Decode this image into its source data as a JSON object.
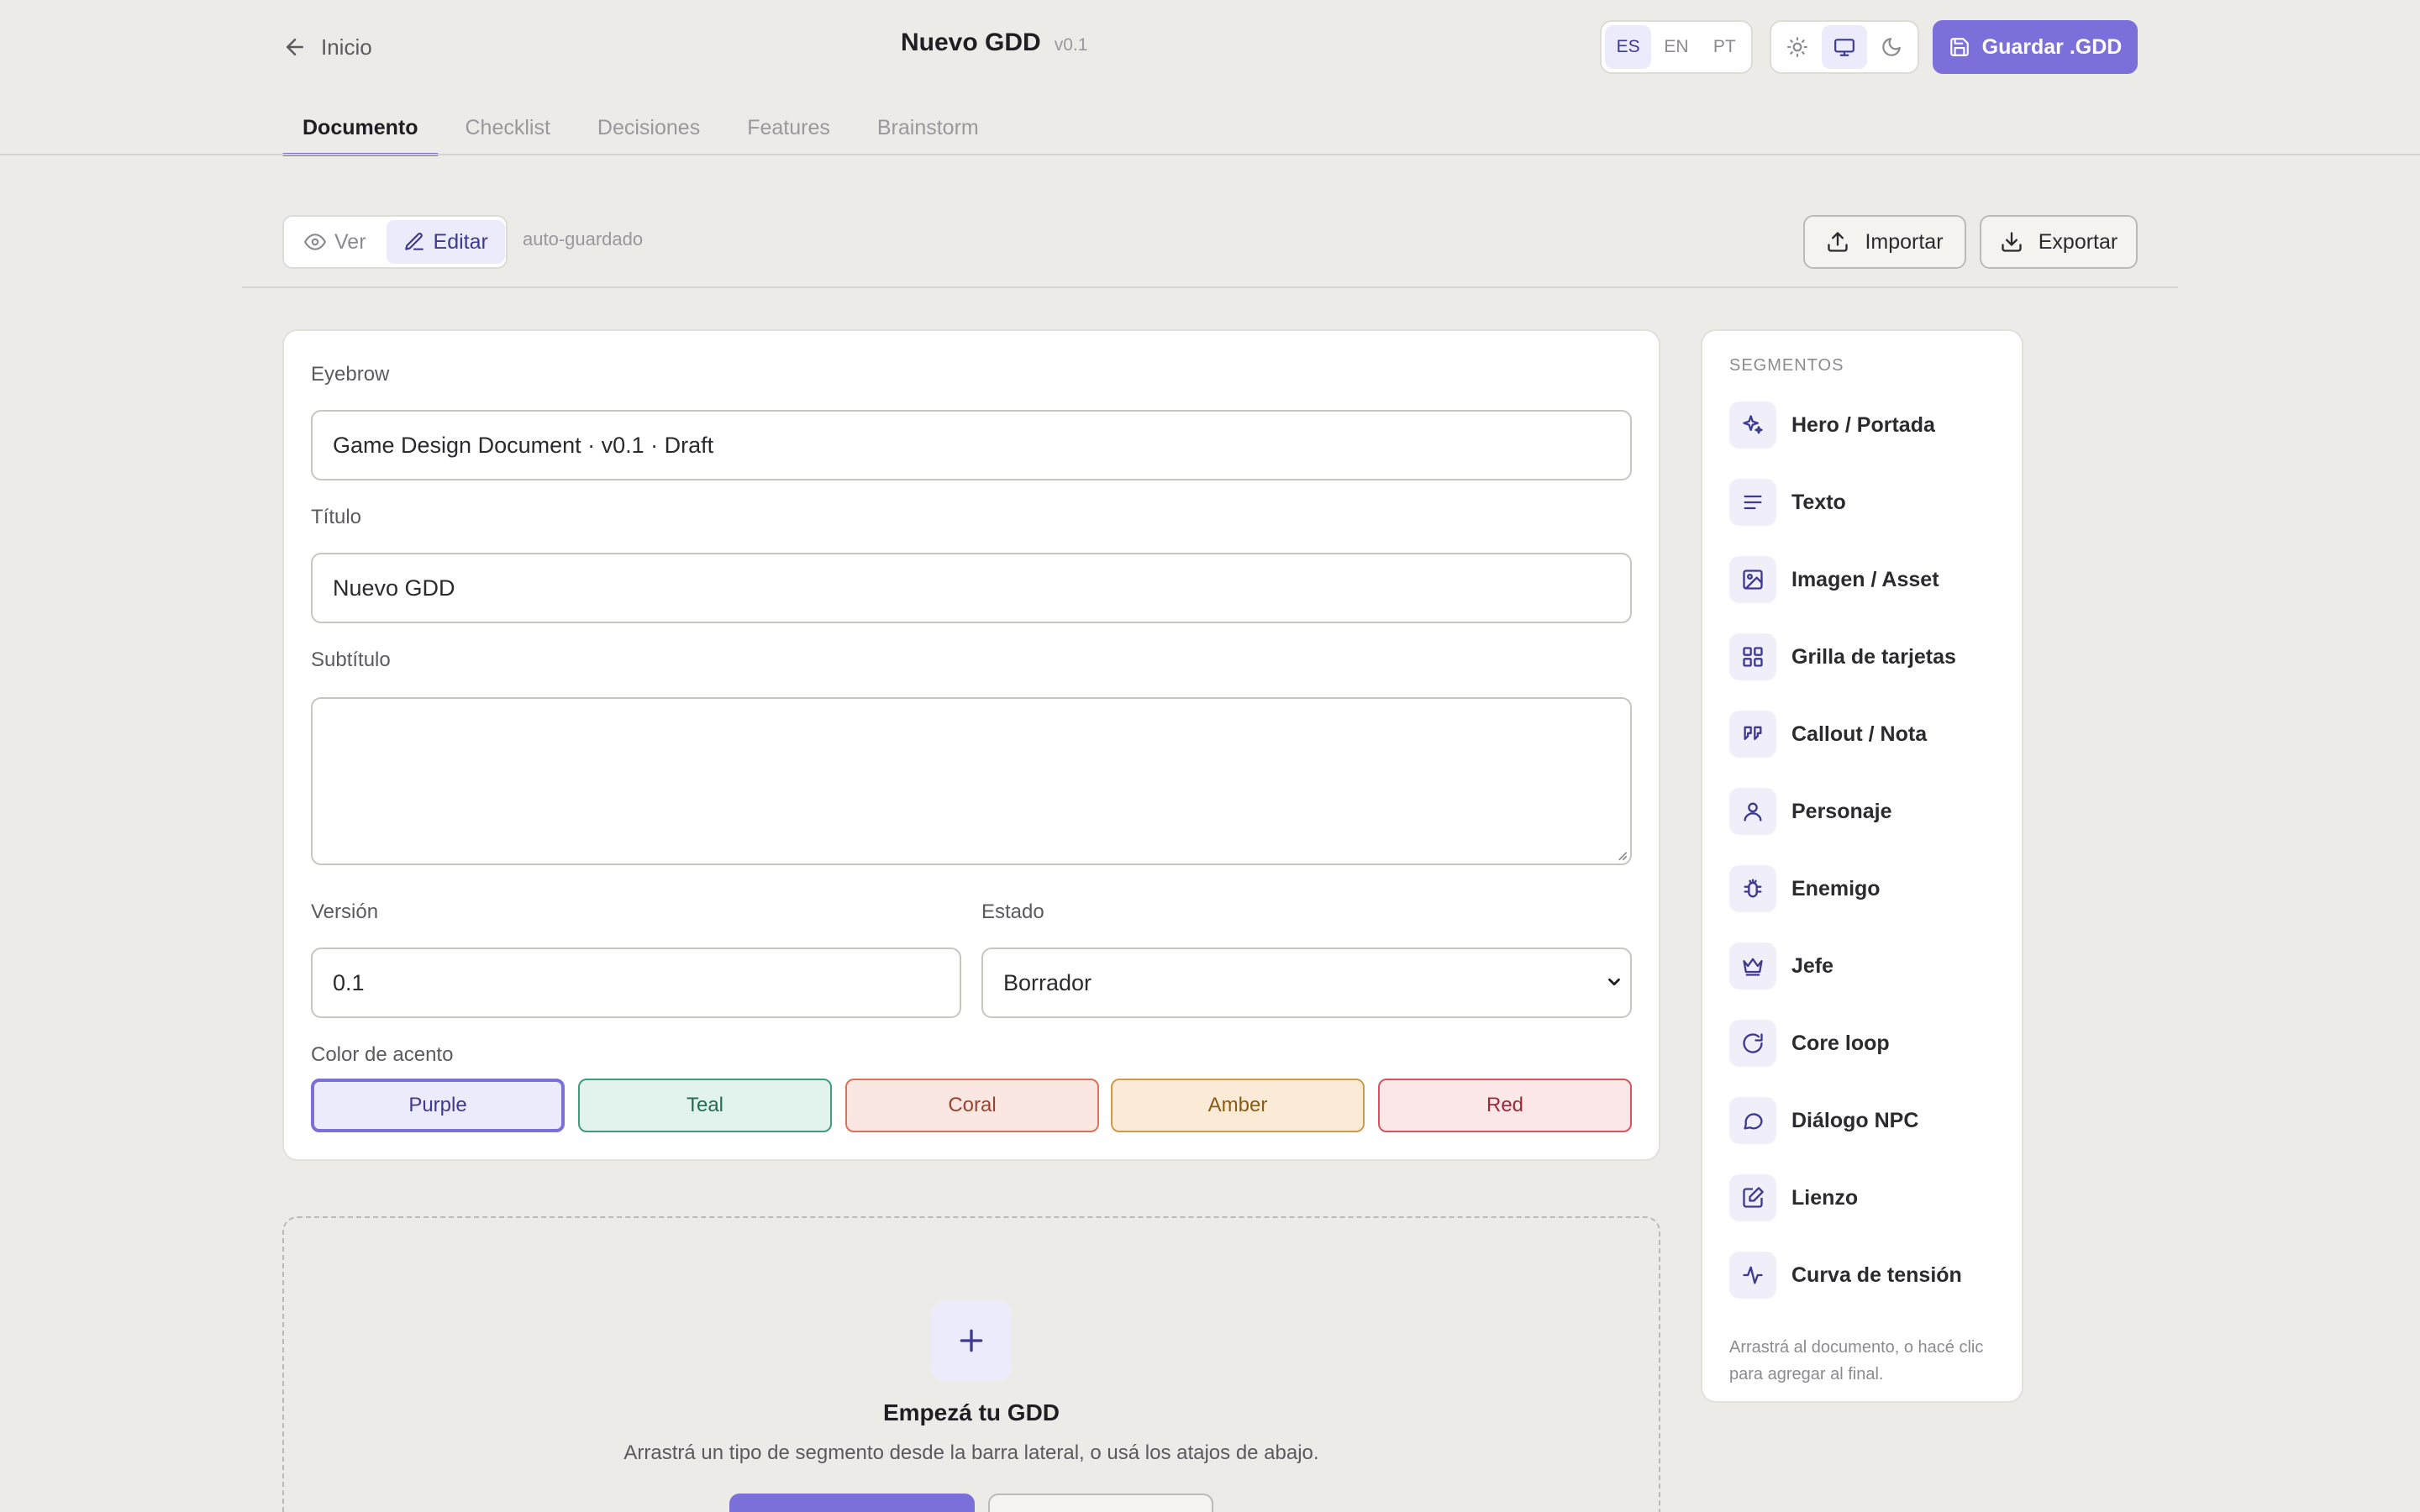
{
  "header": {
    "back_label": "Inicio",
    "doc_title": "Nuevo GDD",
    "doc_version": "v0.1",
    "languages": [
      "ES",
      "EN",
      "PT"
    ],
    "active_language": "ES",
    "theme_options": [
      "sun-icon",
      "monitor-icon",
      "moon-icon"
    ],
    "active_theme": "monitor-icon",
    "save_label": "Guardar .GDD"
  },
  "tabs": [
    {
      "label": "Documento",
      "active": true
    },
    {
      "label": "Checklist",
      "active": false
    },
    {
      "label": "Decisiones",
      "active": false
    },
    {
      "label": "Features",
      "active": false
    },
    {
      "label": "Brainstorm",
      "active": false
    }
  ],
  "toolbar": {
    "view_label": "Ver",
    "edit_label": "Editar",
    "active_mode": "Editar",
    "autosave_label": "auto-guardado",
    "import_label": "Importar",
    "export_label": "Exportar"
  },
  "form": {
    "eyebrow_label": "Eyebrow",
    "eyebrow_value": "Game Design Document · v0.1 · Draft",
    "title_label": "Título",
    "title_value": "Nuevo GDD",
    "subtitle_label": "Subtítulo",
    "subtitle_value": "",
    "version_label": "Versión",
    "version_value": "0.1",
    "status_label": "Estado",
    "status_value": "Borrador",
    "accent_label": "Color de acento",
    "accents": [
      {
        "name": "Purple",
        "bg": "#ecebfb",
        "border": "#7b6fd9",
        "text": "#3d3a8f",
        "selected": true
      },
      {
        "name": "Teal",
        "bg": "#e1f3ec",
        "border": "#3f9c7c",
        "text": "#256b53",
        "selected": false
      },
      {
        "name": "Coral",
        "bg": "#fae7e2",
        "border": "#d9735c",
        "text": "#9a4232",
        "selected": false
      },
      {
        "name": "Amber",
        "bg": "#fbebd6",
        "border": "#d39a45",
        "text": "#8a5a18",
        "selected": false
      },
      {
        "name": "Red",
        "bg": "#fbe6e8",
        "border": "#d65460",
        "text": "#9b2a35",
        "selected": false
      }
    ]
  },
  "empty_state": {
    "title": "Empezá tu GDD",
    "subtitle": "Arrastrá un tipo de segmento desde la barra lateral, o usá los atajos de abajo."
  },
  "sidebar": {
    "heading": "SEGMENTOS",
    "items": [
      {
        "label": "Hero / Portada",
        "icon": "sparkles-icon"
      },
      {
        "label": "Texto",
        "icon": "text-lines-icon"
      },
      {
        "label": "Imagen / Asset",
        "icon": "image-icon"
      },
      {
        "label": "Grilla de tarjetas",
        "icon": "grid-icon"
      },
      {
        "label": "Callout / Nota",
        "icon": "quote-icon"
      },
      {
        "label": "Personaje",
        "icon": "user-icon"
      },
      {
        "label": "Enemigo",
        "icon": "bug-icon"
      },
      {
        "label": "Jefe",
        "icon": "crown-icon"
      },
      {
        "label": "Core loop",
        "icon": "refresh-icon"
      },
      {
        "label": "Diálogo NPC",
        "icon": "chat-icon"
      },
      {
        "label": "Lienzo",
        "icon": "canvas-icon"
      },
      {
        "label": "Curva de tensión",
        "icon": "pulse-icon"
      }
    ],
    "hint": "Arrastrá al documento, o hacé clic para agregar al final."
  },
  "colors": {
    "accent": "#7b6fd9",
    "background": "#edebe7",
    "card": "#ffffff"
  }
}
